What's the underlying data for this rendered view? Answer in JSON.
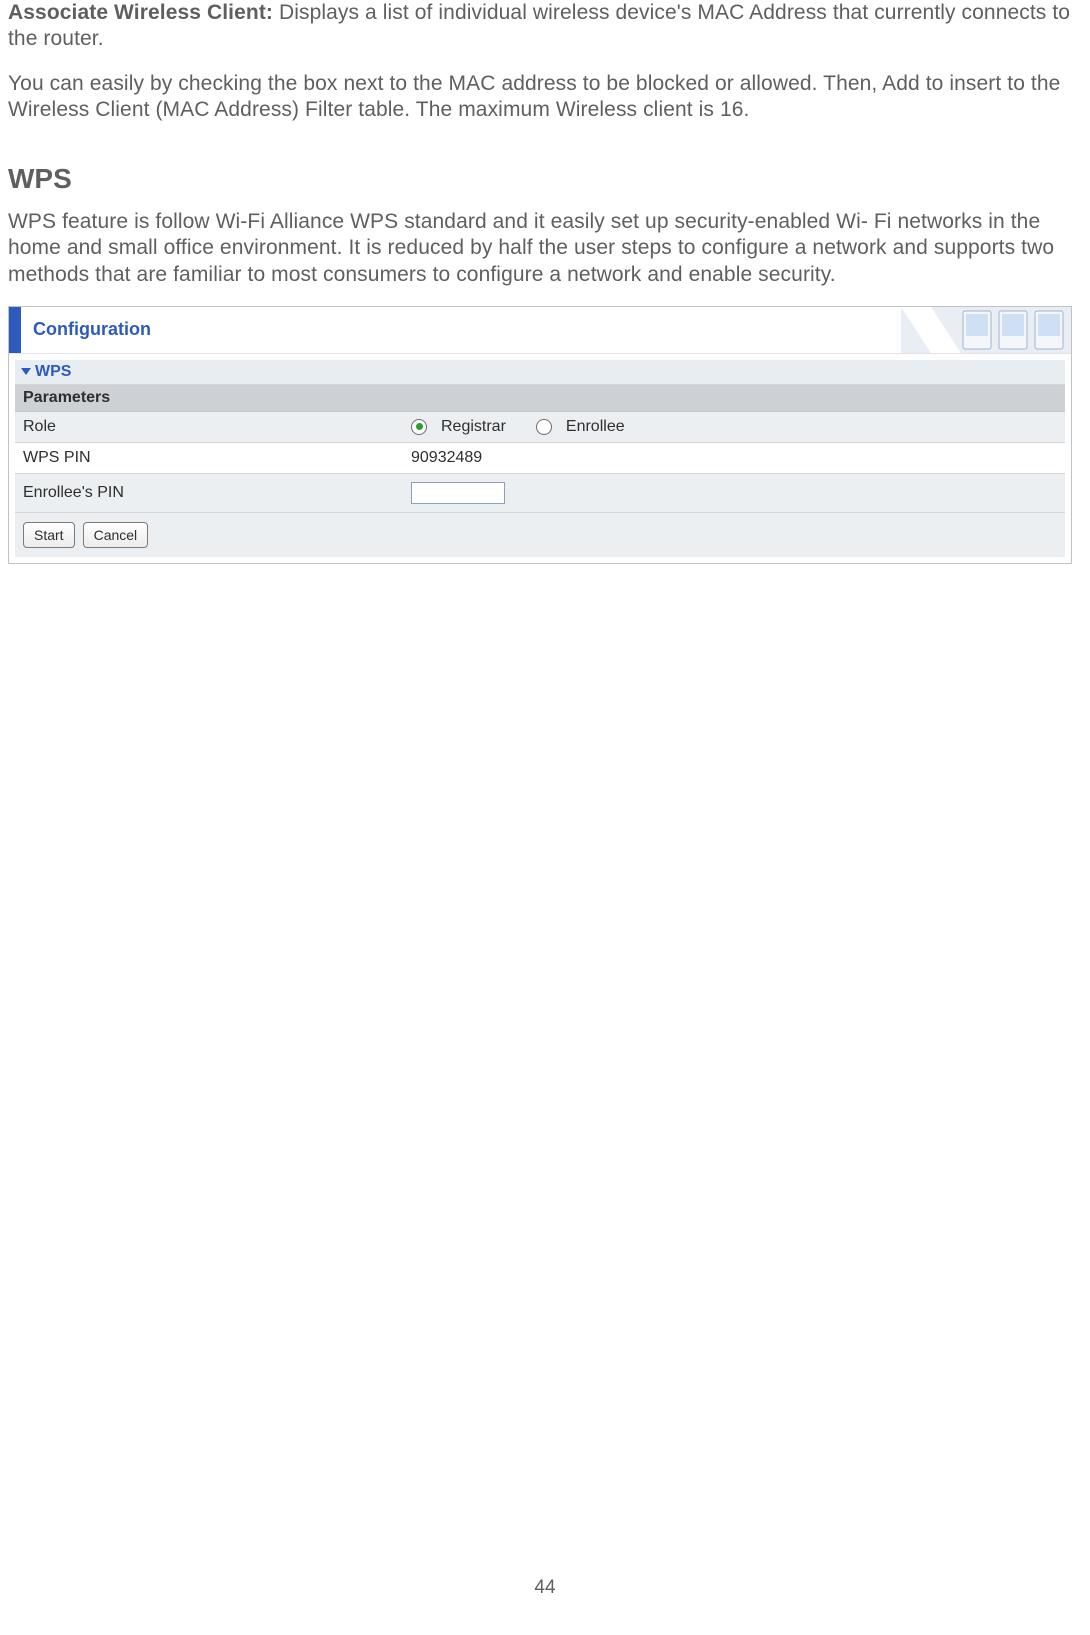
{
  "doc": {
    "awc_label": "Associate Wireless Client:",
    "awc_text": " Displays a list of individual wireless device's MAC Address that currently connects to the router.",
    "awc_p2": "You can easily by checking the box next to the MAC address to be blocked or allowed. Then, Add to insert to the Wireless Client (MAC Address) Filter table.  The maximum Wireless client is 16.",
    "wps_heading": "WPS",
    "wps_desc": "WPS feature is follow Wi-Fi Alliance WPS standard and it easily set up security-enabled Wi- Fi networks in the home and small office environment. It is reduced by half the user steps to configure a network and supports two methods that are familiar to most consumers to configure a network and enable security.",
    "page_number": "44"
  },
  "panel": {
    "header_title": "Configuration",
    "section_title": "WPS",
    "params_title": "Parameters",
    "rows": {
      "role": {
        "label": "Role",
        "opt1": "Registrar",
        "opt2": "Enrollee",
        "selected": "Registrar"
      },
      "wps_pin": {
        "label": "WPS PIN",
        "value": "90932489"
      },
      "enrollee_pin": {
        "label": "Enrollee's PIN",
        "value": ""
      }
    },
    "buttons": {
      "start": "Start",
      "cancel": "Cancel"
    }
  }
}
